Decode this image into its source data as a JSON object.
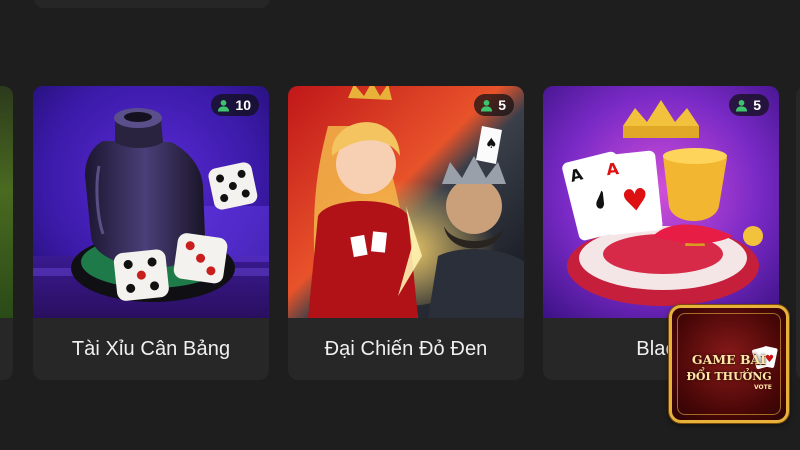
{
  "games": [
    {
      "title": "Tài Xỉu Cân Bảng",
      "players": "10",
      "theme": "purple"
    },
    {
      "title": "Đại Chiến Đỏ Đen",
      "players": "5",
      "theme": "red"
    },
    {
      "title": "Black",
      "players": "5",
      "theme": "violet"
    }
  ],
  "logo": {
    "line1": "GAME BÀI",
    "line2": "ĐỔI THƯỞNG",
    "sub": "VOTE"
  },
  "colors": {
    "background": "#1e1e1e",
    "card": "#272727",
    "badge_icon": "#3ec46d",
    "logo_border": "#e8b23a"
  }
}
